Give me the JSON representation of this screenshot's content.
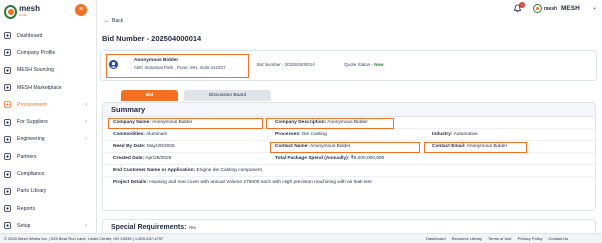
{
  "app": {
    "logo_text": "mesh",
    "logo_sub": "works",
    "collapse_symbol": "≡"
  },
  "sidebar": {
    "items": [
      {
        "label": "Dashboard",
        "icon": "dashboard-icon",
        "active": false,
        "chevron": false
      },
      {
        "label": "Company Profile",
        "icon": "building-icon",
        "active": false,
        "chevron": false
      },
      {
        "label": "MESH Sourcing",
        "icon": "sourcing-icon",
        "active": false,
        "chevron": false
      },
      {
        "label": "MESH Marketplace",
        "icon": "marketplace-icon",
        "active": false,
        "chevron": false
      },
      {
        "label": "Procurement",
        "icon": "procurement-icon",
        "active": true,
        "chevron": true
      },
      {
        "label": "For Suppliers",
        "icon": "suppliers-icon",
        "active": false,
        "chevron": true
      },
      {
        "label": "Engineering",
        "icon": "engineering-icon",
        "active": false,
        "chevron": true
      },
      {
        "label": "Partners",
        "icon": "partners-icon",
        "active": false,
        "chevron": false
      },
      {
        "label": "Compliance",
        "icon": "compliance-icon",
        "active": false,
        "chevron": false
      },
      {
        "label": "Parts Library",
        "icon": "parts-icon",
        "active": false,
        "chevron": false
      },
      {
        "label": "Reports",
        "icon": "reports-icon",
        "active": false,
        "chevron": false
      },
      {
        "label": "Setup",
        "icon": "setup-icon",
        "active": false,
        "chevron": true
      }
    ]
  },
  "header": {
    "notification_count": "1",
    "user_logo_text": "mesh",
    "user_name": "MESH",
    "user_chevron": "⌄"
  },
  "main": {
    "back_label": "Back",
    "bid_title": "Bid Number - 202504000014",
    "bidder": {
      "name": "Anonymous Bidder",
      "address": "ABC Industrial Park , Pune, MH, India 412207",
      "bid_number": "Bid Number - 202504000014",
      "quote_status_label": "Quote Status - ",
      "quote_status_value": "New"
    },
    "tabs": {
      "bid": "Bid",
      "discussion": "Discussion Board"
    },
    "summary": {
      "title": "Summary",
      "company_name_label": "Company Name:",
      "company_name_value": "Anonymous Bidder",
      "company_description_label": "Company Description:",
      "company_description_value": "Anonymous Bidder",
      "commodities_label": "Commodities:",
      "commodities_value": "Aluminum",
      "processes_label": "Processes:",
      "processes_value": "Die Casting",
      "industry_label": "Industry:",
      "industry_value": "Automotive",
      "need_by_label": "Need By Date:",
      "need_by_value": "May/30/2025",
      "contact_name_label": "Contact Name:",
      "contact_name_value": "Anonymous Bidder",
      "contact_email_label": "Contact Email:",
      "contact_email_value": "Anonymous Bidder",
      "created_label": "Created Date:",
      "created_value": "Apr/28/2025",
      "package_spend_label": "Total Package Spend (Annually):",
      "package_spend_value": "₹5,000,000,000",
      "end_customer_label": "End Customer Name or Application:",
      "end_customer_value": "Engine die Casting component",
      "project_details_label": "Project Details:",
      "project_details_value": "Housing and rear cover with annual Volume 275000 each with High precision machining with air leak test"
    },
    "special_requirements_label": "Special Requirements:",
    "special_requirements_value": "Yes"
  },
  "footer": {
    "copyright": "2025 Mesh Works Inc.",
    "address": "  |   925 Bear Run Lane, Lewis Center, OH 43035   |   1-800-637-4757",
    "links": [
      "Dashboard",
      "Resource Library",
      "Terms of Use",
      "Privacy Policy",
      "Contact Us"
    ]
  },
  "colors": {
    "accent": "#f36f21",
    "brand_green": "#2e7d32",
    "status_new": "#2e7d32",
    "text": "#1f2a44"
  }
}
